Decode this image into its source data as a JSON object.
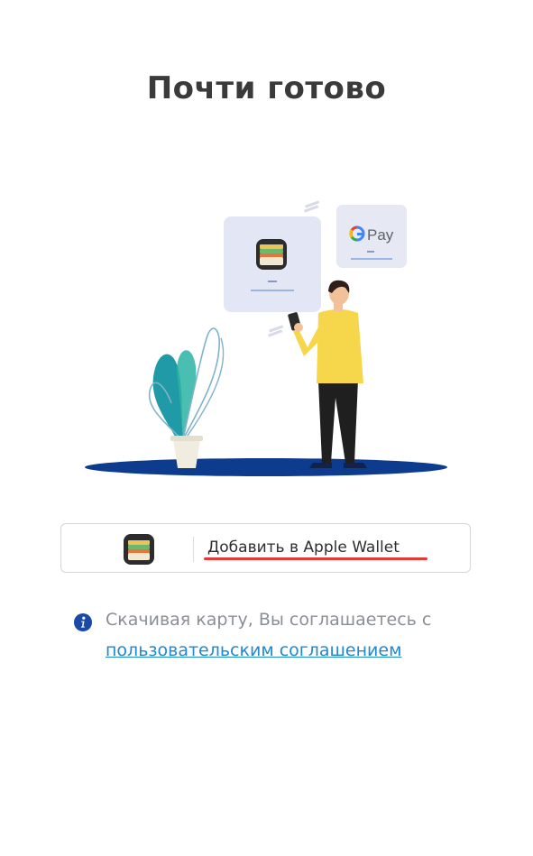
{
  "header": {
    "title": "Почти готово"
  },
  "illustration": {
    "gpay_card_label": "Pay",
    "icons": [
      "apple-wallet-icon",
      "google-pay-logo",
      "person-with-phone",
      "plant-in-pot"
    ]
  },
  "wallet_button": {
    "label": "Добавить в Apple Wallet",
    "icon": "apple-wallet-icon",
    "highlight_color": "#e53935"
  },
  "info": {
    "icon": "info-icon",
    "text": "Скачивая карту, Вы соглашаетесь с",
    "link_text": "пользовательским соглашением",
    "link_color": "#1e88d6",
    "icon_color": "#1a4aa6"
  }
}
